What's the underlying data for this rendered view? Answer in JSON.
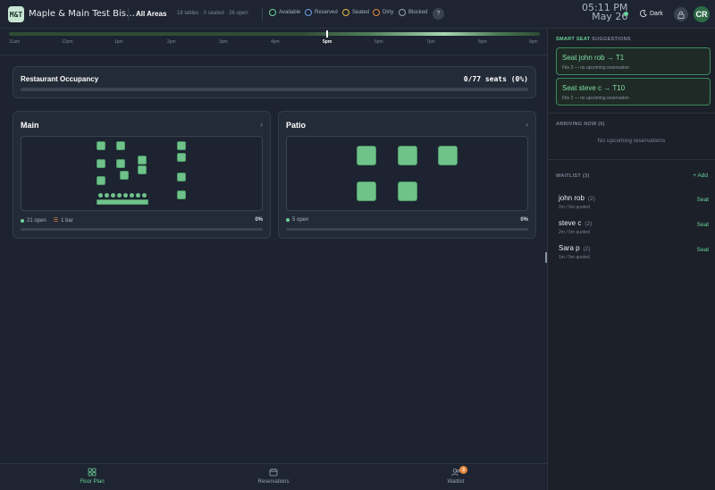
{
  "header": {
    "logo_text": "M&T",
    "venue_name": "Maple & Main Test Bis…",
    "area_label": "All Areas",
    "stats_text": "18 tables · 0 seated · 26 open",
    "legend": [
      {
        "label": "Available",
        "color": "#6bd39a"
      },
      {
        "label": "Reserved",
        "color": "#6f9be8"
      },
      {
        "label": "Seated",
        "color": "#e8b94a"
      },
      {
        "label": "Dirty",
        "color": "#e5893d"
      },
      {
        "label": "Blocked",
        "color": "#9aa3b1"
      }
    ],
    "help_label": "?",
    "time": "05:11 PM",
    "date": "May 26",
    "theme_label": "Dark",
    "avatar_initials": "CR"
  },
  "timeline": {
    "ticks": [
      "11am",
      "12pm",
      "1pm",
      "2pm",
      "3pm",
      "4pm",
      "5pm",
      "6pm",
      "7pm",
      "8pm",
      "9pm"
    ],
    "current": "5pm"
  },
  "occupancy": {
    "title": "Restaurant Occupancy",
    "value": "0/77 seats (0%)",
    "fraction": 0
  },
  "rooms": {
    "main": {
      "name": "Main",
      "open_label": "21 open",
      "bar_label": "1 bar",
      "percent": "0%"
    },
    "patio": {
      "name": "Patio",
      "open_label": "5 open",
      "percent": "0%"
    }
  },
  "nav": {
    "floor_plan": "Floor Plan",
    "reservations": "Reservations",
    "waitlist": "Waitlist",
    "waitlist_badge": "3"
  },
  "sidebar": {
    "smart_title_accent": "SMART SEAT",
    "smart_title_rest": " SUGGESTIONS",
    "suggestions": [
      {
        "title": "Seat john rob → T1",
        "sub": "Fits 2 — no upcoming reservation"
      },
      {
        "title": "Seat steve c → T10",
        "sub": "Fits 2 — no upcoming reservation"
      }
    ],
    "arriving_title": "ARRIVING NOW (0)",
    "arriving_empty": "No upcoming reservations",
    "waitlist_title": "WAITLIST (3)",
    "add_label": "+ Add",
    "waitlist": [
      {
        "name": "john rob",
        "party": "(2)",
        "wait": "2m / 5m quoted",
        "action": "Seat"
      },
      {
        "name": "steve c",
        "party": "(2)",
        "wait": "2m / 5m quoted",
        "action": "Seat"
      },
      {
        "name": "Sara p",
        "party": "(2)",
        "wait": "1m / 5m quoted",
        "action": "Seat"
      }
    ]
  }
}
